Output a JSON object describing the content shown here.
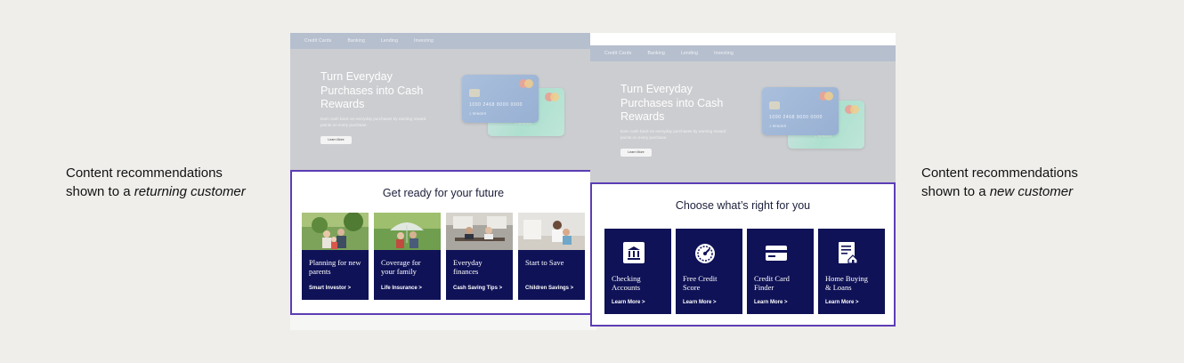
{
  "captions": {
    "left": {
      "line1": "Content recommendations",
      "line2_prefix": "shown to a ",
      "line2_emphasis": "returning customer"
    },
    "right": {
      "line1": "Content recommendations",
      "line2_prefix": "shown to a ",
      "line2_emphasis": "new customer"
    }
  },
  "nav": [
    "Credit Cards",
    "Banking",
    "Lending",
    "Investing"
  ],
  "hero": {
    "title": "Turn Everyday Purchases into Cash Rewards",
    "subtitle": "Earn cash back on everyday purchases by earning reward points on every purchase.",
    "button": "Learn More"
  },
  "card": {
    "number": "1000 2468 8000 0000",
    "name": "J. RENGER",
    "back_name": "J. RENGER"
  },
  "returning": {
    "title": "Get ready for your future",
    "tiles": [
      {
        "label": "Planning for new parents",
        "link": "Smart Investor >",
        "image": "family-photo"
      },
      {
        "label": "Coverage for your family",
        "link": "Life Insurance >",
        "image": "umbrella-photo"
      },
      {
        "label": "Everyday finances",
        "link": "Cash Saving Tips >",
        "image": "kitchen-photo"
      },
      {
        "label": "Start to Save",
        "link": "Children Savings >",
        "image": "parent-child-photo"
      }
    ]
  },
  "new_customer": {
    "title": "Choose what’s right for you",
    "tiles": [
      {
        "label": "Checking Accounts",
        "link": "Learn More >",
        "icon": "bank-icon"
      },
      {
        "label": "Free Credit Score",
        "link": "Learn More >",
        "icon": "gauge-icon"
      },
      {
        "label": "Credit Card Finder",
        "link": "Learn More >",
        "icon": "credit-card-icon"
      },
      {
        "label": "Home Buying & Loans",
        "link": "Learn More >",
        "icon": "home-document-icon"
      }
    ]
  },
  "colors": {
    "accent_border": "#5c3db4",
    "tile_navy": "#0f1257",
    "background": "#efeeeb"
  }
}
